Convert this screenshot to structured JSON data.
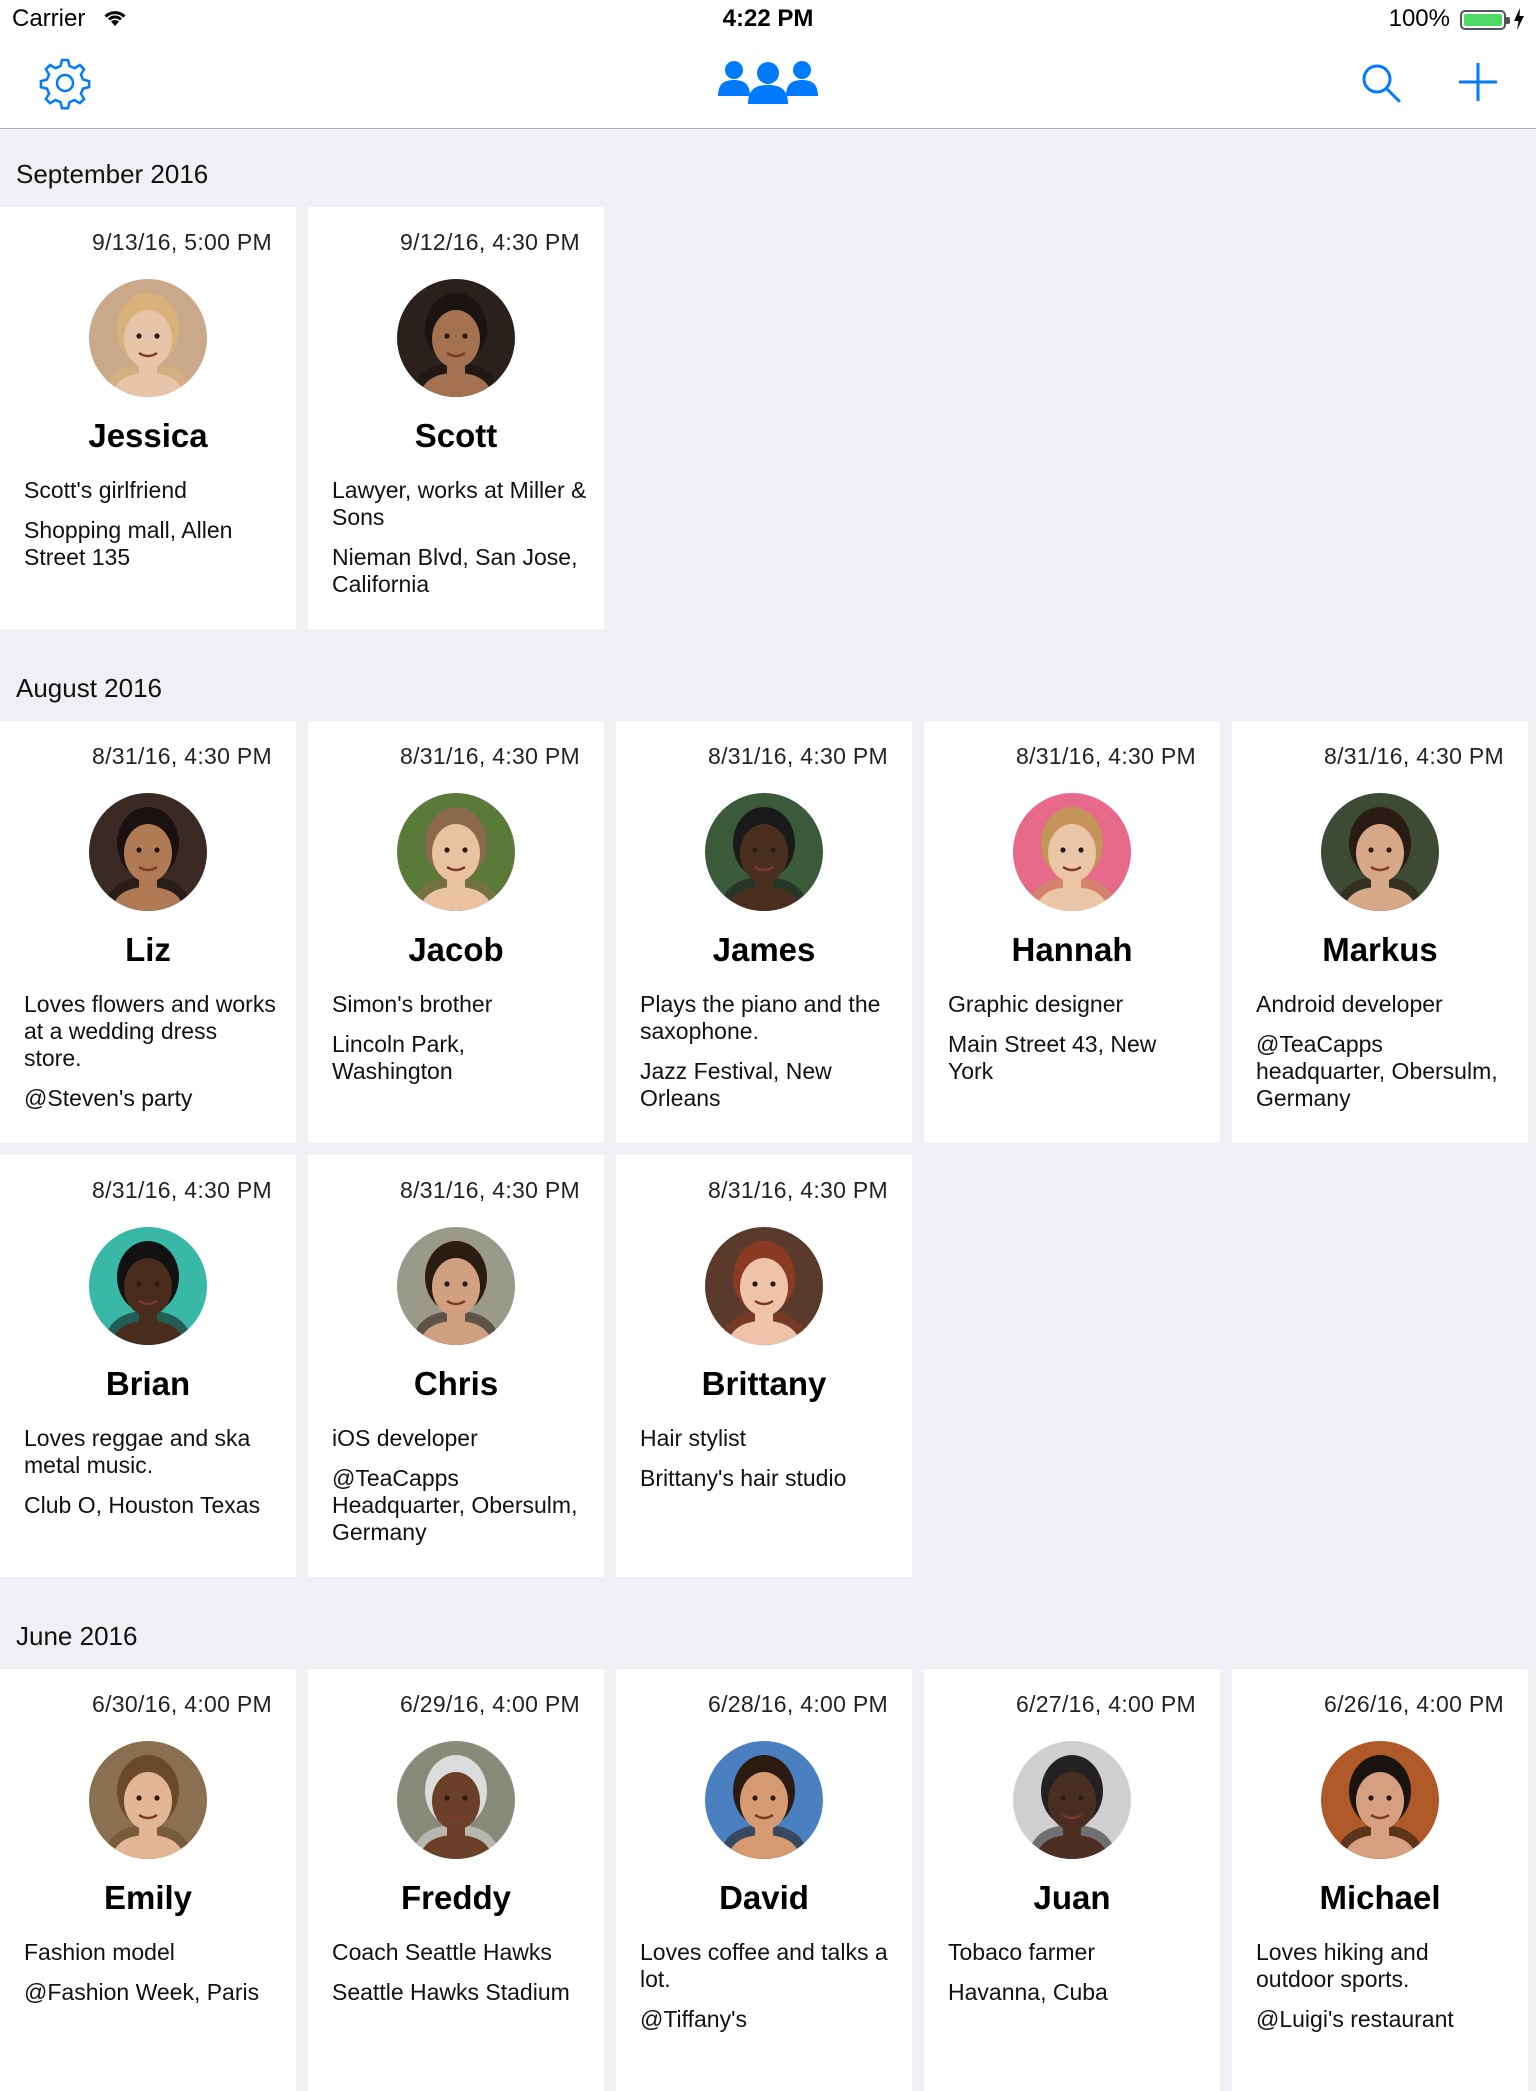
{
  "status_bar": {
    "carrier": "Carrier",
    "time": "4:22 PM",
    "battery": "100%"
  },
  "nav": {
    "settings_icon": "gear-icon",
    "title_icon": "group-icon",
    "search_icon": "search-icon",
    "add_icon": "plus-icon",
    "accent": "#007aff"
  },
  "sections": [
    {
      "title": "September 2016",
      "cards": [
        {
          "date": "9/13/16, 5:00 PM",
          "name": "Jessica",
          "desc": "Scott's girlfriend",
          "location": "Shopping mall, Allen Street 135",
          "skin": "#e8c4a8",
          "hair": "#d9b27a",
          "bg": "#c9a98a"
        },
        {
          "date": "9/12/16, 4:30 PM",
          "name": "Scott",
          "desc": "Lawyer, works at Miller & Sons",
          "location": "Nieman Blvd, San Jose, California",
          "skin": "#a47250",
          "hair": "#1b1410",
          "bg": "#2a211c"
        }
      ]
    },
    {
      "title": "August 2016",
      "cards": [
        {
          "date": "8/31/16, 4:30 PM",
          "name": "Liz",
          "desc": "Loves flowers and works at a wedding dress store.",
          "location": "@Steven's party",
          "skin": "#b07a55",
          "hair": "#1a1210",
          "bg": "#3b2a24"
        },
        {
          "date": "8/31/16, 4:30 PM",
          "name": "Jacob",
          "desc": "Simon's brother",
          "location": "Lincoln Park, Washington",
          "skin": "#e9c2a2",
          "hair": "#8a6a4a",
          "bg": "#5a7a3a"
        },
        {
          "date": "8/31/16, 4:30 PM",
          "name": "James",
          "desc": "Plays the piano and the saxophone.",
          "location": "Jazz Festival, New Orleans",
          "skin": "#4a2e1e",
          "hair": "#1a1a1a",
          "bg": "#3a5a3a"
        },
        {
          "date": "8/31/16, 4:30 PM",
          "name": "Hannah",
          "desc": "Graphic designer",
          "location": "Main Street 43, New York",
          "skin": "#eac6a6",
          "hair": "#c4955a",
          "bg": "#e86a8a"
        },
        {
          "date": "8/31/16, 4:30 PM",
          "name": "Markus",
          "desc": "Android developer",
          "location": "@TeaCapps headquarter, Obersulm, Germany",
          "skin": "#d7a888",
          "hair": "#2a1c14",
          "bg": "#3d4a34"
        },
        {
          "date": "8/31/16, 4:30 PM",
          "name": "Brian",
          "desc": "Loves reggae and ska metal music.",
          "location": "Club O, Houston Texas",
          "skin": "#4a2c1c",
          "hair": "#111",
          "bg": "#39b8a8"
        },
        {
          "date": "8/31/16, 4:30 PM",
          "name": "Chris",
          "desc": "iOS developer",
          "location": "@TeaCapps Headquarter, Obersulm, Germany",
          "skin": "#d0a080",
          "hair": "#2a1c12",
          "bg": "#9a9a8a"
        },
        {
          "date": "8/31/16, 4:30 PM",
          "name": "Brittany",
          "desc": "Hair stylist",
          "location": "Brittany's hair studio",
          "skin": "#eec3aa",
          "hair": "#8a3a22",
          "bg": "#5a3a2a"
        }
      ]
    },
    {
      "title": "June 2016",
      "cards": [
        {
          "date": "6/30/16, 4:00 PM",
          "name": "Emily",
          "desc": "Fashion model",
          "location": "@Fashion Week, Paris",
          "skin": "#e2b594",
          "hair": "#6a4a2a",
          "bg": "#8a7050"
        },
        {
          "date": "6/29/16, 4:00 PM",
          "name": "Freddy",
          "desc": "Coach Seattle Hawks",
          "location": "Seattle Hawks Stadium",
          "skin": "#6a4028",
          "hair": "#dcdcdc",
          "bg": "#8a8a7a"
        },
        {
          "date": "6/28/16, 4:00 PM",
          "name": "David",
          "desc": "Loves coffee and talks a lot.",
          "location": "@Tiffany's",
          "skin": "#d69a72",
          "hair": "#2a1a10",
          "bg": "#4a80c0"
        },
        {
          "date": "6/27/16, 4:00 PM",
          "name": "Juan",
          "desc": "Tobaco farmer",
          "location": "Havanna, Cuba",
          "skin": "#4a2e22",
          "hair": "#222",
          "bg": "#cfcfcf"
        },
        {
          "date": "6/26/16, 4:00 PM",
          "name": "Michael",
          "desc": "Loves hiking and outdoor sports.",
          "location": "@Luigi's restaurant",
          "skin": "#d6a080",
          "hair": "#1a1410",
          "bg": "#b05a2a"
        }
      ]
    }
  ]
}
